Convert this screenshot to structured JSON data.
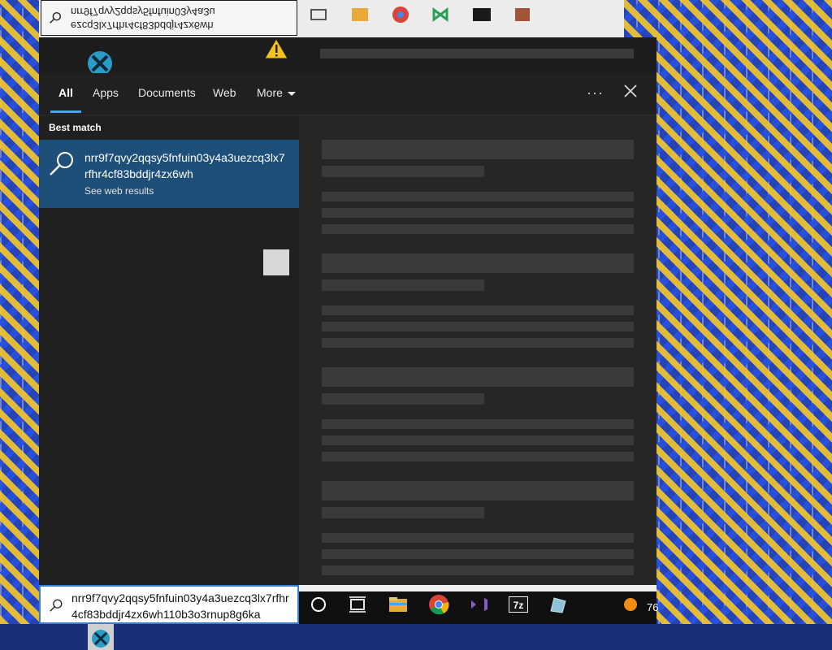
{
  "ghost_search": {
    "line1": "nrr9f7qvy2qqsy5fnfuin03y4a3u",
    "line2": "ezcq3lx7rfhr4cf83bddjr4zx6wh"
  },
  "tabs": [
    {
      "label": "All"
    },
    {
      "label": "Apps"
    },
    {
      "label": "Documents"
    },
    {
      "label": "Web"
    },
    {
      "label": "More"
    }
  ],
  "best_match": {
    "heading": "Best match",
    "title": "nrr9f7qvy2qqsy5fnfuin03y4a3uezcq3lx7rfhr4cf83bddjr4zx6wh",
    "subtitle": "See web results"
  },
  "search_box": {
    "value": "nrr9f7qvy2qqsy5fnfuin03y4a3uezcq3lx7rfhr4cf83bddjr4zx6wh110b3o3rnup8g6ka"
  },
  "taskbar": {
    "count": "76",
    "icons": [
      "cortana-icon",
      "task-view-icon",
      "file-explorer-icon",
      "chrome-icon",
      "visual-studio-icon",
      "7zip-icon",
      "paint-icon",
      "orange-circle-icon"
    ]
  },
  "colors": {
    "accent": "#4aa3f0",
    "selection": "#1e4f78",
    "panel": "#202020"
  }
}
